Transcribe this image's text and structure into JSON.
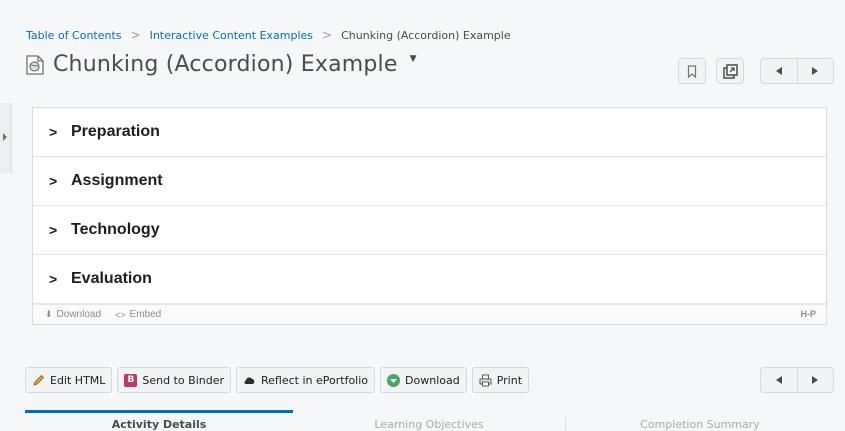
{
  "breadcrumb": {
    "items": [
      "Table of Contents",
      "Interactive Content Examples"
    ],
    "current": "Chunking (Accordion) Example"
  },
  "page": {
    "title": "Chunking (Accordion) Example"
  },
  "accordion": {
    "items": [
      "Preparation",
      "Assignment",
      "Technology",
      "Evaluation"
    ]
  },
  "h5p_footer": {
    "download": "Download",
    "embed": "Embed",
    "logo": "H-P"
  },
  "actions": {
    "edit_html": "Edit HTML",
    "send_to_binder": "Send to Binder",
    "reflect": "Reflect in ePortfolio",
    "download": "Download",
    "print": "Print"
  },
  "tabs": [
    "Activity Details",
    "Learning Objectives",
    "Completion Summary"
  ],
  "colors": {
    "link": "#006fbf",
    "accent": "#006fbf",
    "binder": "#c0395c",
    "download": "#46a661"
  }
}
